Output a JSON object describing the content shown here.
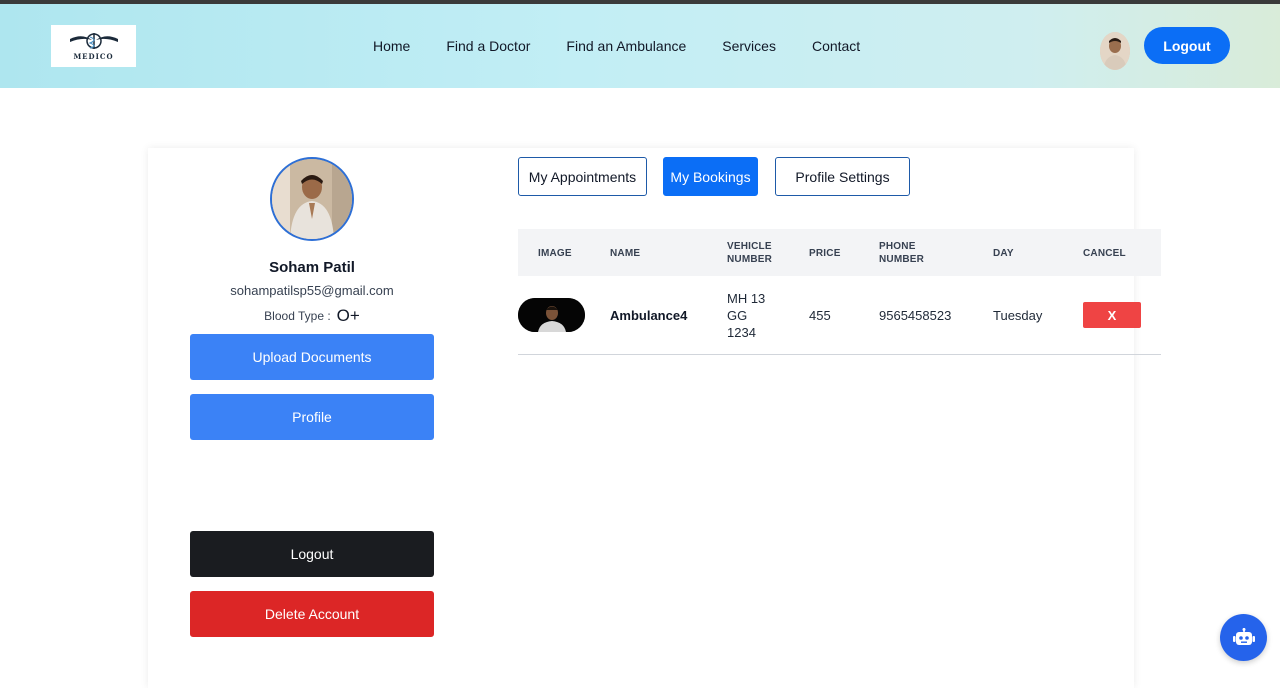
{
  "header": {
    "logo_text": "MEDICO",
    "nav": [
      "Home",
      "Find a Doctor",
      "Find an Ambulance",
      "Services",
      "Contact"
    ],
    "logout_label": "Logout"
  },
  "profile": {
    "name": "Soham Patil",
    "email": "sohampatilsp55@gmail.com",
    "blood_type_label": "Blood Type :",
    "blood_type_value": "O+",
    "upload_label": "Upload Documents",
    "profile_label": "Profile",
    "logout_label": "Logout",
    "delete_label": "Delete Account"
  },
  "tabs": {
    "appointments": "My Appointments",
    "bookings": "My Bookings",
    "settings": "Profile Settings",
    "active": "bookings"
  },
  "table": {
    "headers": {
      "image": "IMAGE",
      "name": "NAME",
      "vehicle_1": "VEHICLE",
      "vehicle_2": "NUMBER",
      "price": "PRICE",
      "phone_1": "PHONE",
      "phone_2": "NUMBER",
      "day": "DAY",
      "cancel": "CANCEL"
    },
    "rows": [
      {
        "name": "Ambulance4",
        "vehicle_1": "MH 13",
        "vehicle_2": "GG",
        "vehicle_3": "1234",
        "price": "455",
        "phone": "9565458523",
        "day": "Tuesday",
        "cancel_label": "X"
      }
    ]
  },
  "colors": {
    "primary": "#0b6ef6",
    "button_blue": "#3b82f6",
    "danger": "#dc2626",
    "dark": "#1a1c20"
  }
}
